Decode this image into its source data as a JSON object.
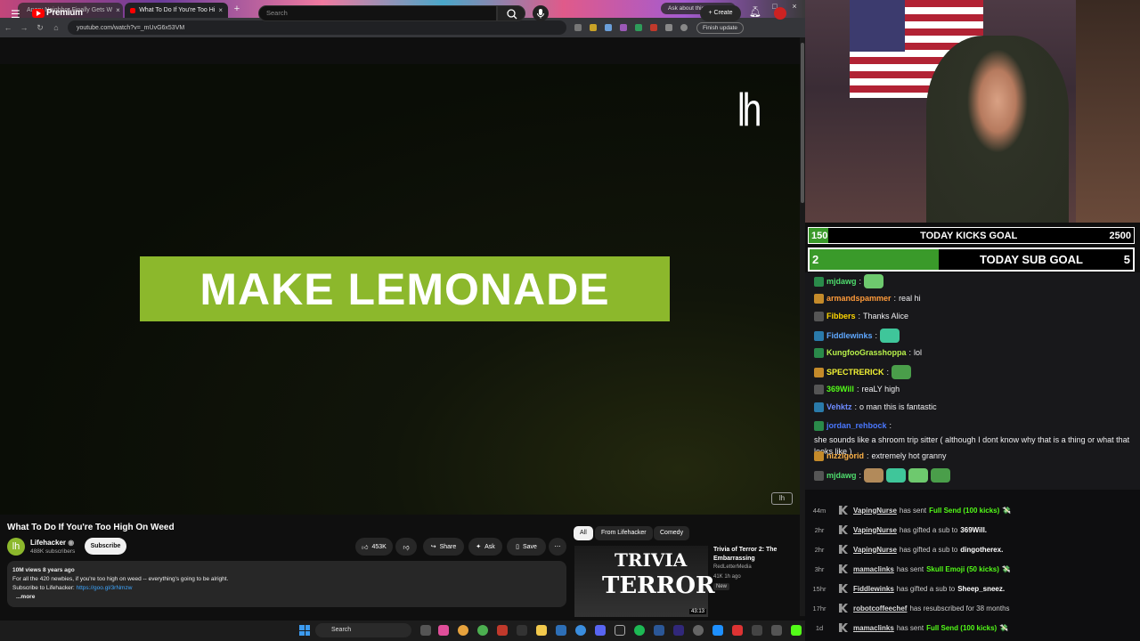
{
  "browser": {
    "tabs": [
      {
        "title": "Angry Neighbor Finally Gets W"
      },
      {
        "title": "What To Do If You're Too Hi"
      }
    ],
    "ask_button": "Ask about this page?",
    "url": "youtube.com/watch?v=_mUvG6x53VM",
    "finish_update": "Finish update"
  },
  "youtube": {
    "brand": "Premium",
    "search_placeholder": "Search",
    "create_label": "Create"
  },
  "video": {
    "banner_text": "MAKE LEMONADE",
    "watermark": "lh",
    "small_logo": "lh"
  },
  "watch": {
    "title": "What To Do If You're Too High On Weed",
    "channel": "Lifehacker",
    "channel_initial": "lh",
    "subscribers": "488K subscribers",
    "subscribe_label": "Subscribe",
    "likes": "453K",
    "share_label": "Share",
    "ask_label": "Ask",
    "save_label": "Save",
    "desc_meta": "10M views  8 years ago",
    "desc_line1": "For all the 420 newbies, if you're too high on weed -- everything's going to be alright.",
    "desc_line2_prefix": "Subscribe to Lifehacker:",
    "desc_link": "https://goo.gl/3rNmzw",
    "desc_more": "...more"
  },
  "recommendations": {
    "chips": [
      "All",
      "From Lifehacker",
      "Comedy"
    ],
    "items": [
      {
        "thumb_line1": "TRIVIA",
        "thumb_line2": "TERROR",
        "duration": "43:13",
        "title": "Trivia of Terror 2: The Embarrassing",
        "channel": "RedLetterMedia",
        "meta": "41K  1h ago",
        "badge": "New"
      }
    ]
  },
  "taskbar": {
    "search_label": "Search"
  },
  "goals": {
    "kicks": {
      "current": "150",
      "label": "TODAY KICKS GOAL",
      "target": "2500",
      "progress": 0.06
    },
    "subs": {
      "current": "2",
      "label": "TODAY SUB GOAL",
      "target": "5",
      "progress": 0.4
    }
  },
  "chat": [
    {
      "user": "mjdawg",
      "color": "#4fdd6e",
      "text": "",
      "emote": true
    },
    {
      "user": "armandspammer",
      "color": "#ff9b3a",
      "text": "real hi"
    },
    {
      "user": "Fibbers",
      "color": "#ffd700",
      "text": "Thanks Alice"
    },
    {
      "user": "Fiddlewinks",
      "color": "#5fa8ff",
      "text": "",
      "emote": true
    },
    {
      "user": "KungfooGrasshoppa",
      "color": "#b7f04a",
      "text": "lol"
    },
    {
      "user": "SPECTRERICK",
      "color": "#f3f335",
      "text": "",
      "emote": true
    },
    {
      "user": "369Will",
      "color": "#53fc18",
      "text": "reaLY high"
    },
    {
      "user": "Vehktz",
      "color": "#6f8cff",
      "text": "o man this is fantastic"
    },
    {
      "user": "jordan_rehbock",
      "color": "#4a78ff",
      "text": "she sounds like a shroom trip sitter ( although I dont know why that is a thing or what that looks like )"
    },
    {
      "user": "nizzigorid",
      "color": "#ffb347",
      "text": "extremely hot granny"
    },
    {
      "user": "mjdawg",
      "color": "#4fdd6e",
      "text": "",
      "emote": true
    }
  ],
  "feed": [
    {
      "time": "44m",
      "user": "VapingNurse",
      "action": "has sent",
      "item": "Full Send (100 kicks)",
      "kind": "kick"
    },
    {
      "time": "2hr",
      "user": "VapingNurse",
      "action": "has gifted a sub to",
      "item": "369Will.",
      "kind": "sub"
    },
    {
      "time": "2hr",
      "user": "VapingNurse",
      "action": "has gifted a sub to",
      "item": "dingotherex.",
      "kind": "sub"
    },
    {
      "time": "3hr",
      "user": "mamaclinks",
      "action": "has sent",
      "item": "Skull Emoji (50 kicks)",
      "kind": "kick"
    },
    {
      "time": "15hr",
      "user": "Fiddlewinks",
      "action": "has gifted a sub to",
      "item": "Sheep_sneez.",
      "kind": "sub"
    },
    {
      "time": "17hr",
      "user": "robotcoffeechef",
      "action": "has resubscribed for 38 months",
      "item": "",
      "kind": "resub"
    },
    {
      "time": "1d",
      "user": "mamaclinks",
      "action": "has sent",
      "item": "Full Send (100 kicks)",
      "kind": "kick"
    }
  ],
  "colors": {
    "banner_green": "#8cb82c",
    "kick_green": "#53fc18",
    "yt_red": "#ff0000"
  }
}
